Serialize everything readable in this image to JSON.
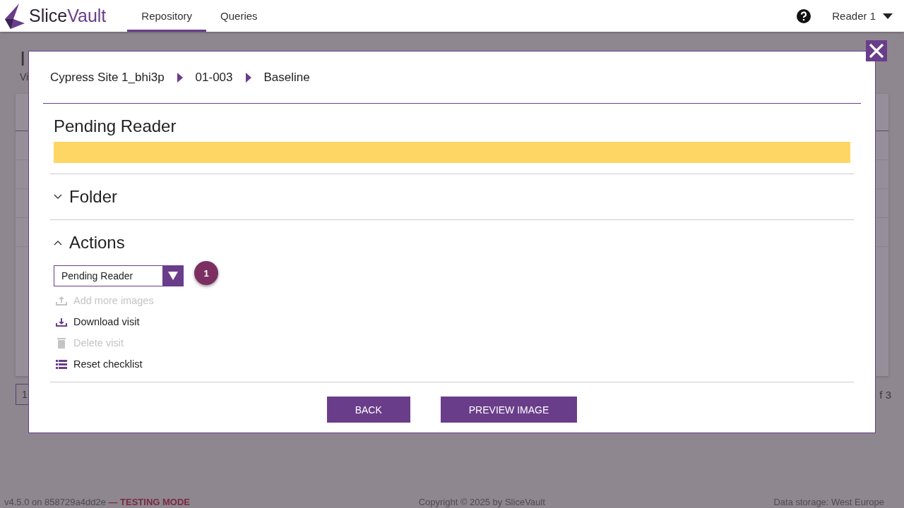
{
  "header": {
    "brand_first": "Slice",
    "brand_second": "Vault",
    "tabs": [
      {
        "label": "Repository",
        "selected": true
      },
      {
        "label": "Queries",
        "selected": false
      }
    ],
    "user": "Reader 1"
  },
  "background": {
    "title": "I",
    "subtitle": "Vi",
    "page": "1",
    "page_count": "f 3"
  },
  "modal": {
    "breadcrumb": [
      "Cypress Site 1_bhi3p",
      "01-003",
      "Baseline"
    ],
    "status": "Pending Reader",
    "sections": [
      {
        "title": "Folder",
        "expanded": false
      },
      {
        "title": "Actions",
        "expanded": true
      }
    ],
    "select_value": "Pending Reader",
    "badge": "1",
    "actions": [
      {
        "label": "Add more images",
        "kind": "upload",
        "disabled": true
      },
      {
        "label": "Download visit",
        "kind": "download",
        "disabled": false
      },
      {
        "label": "Delete visit",
        "kind": "delete",
        "disabled": true
      },
      {
        "label": "Reset checklist",
        "kind": "list",
        "disabled": false
      }
    ],
    "buttons": [
      "BACK",
      "PREVIEW IMAGE"
    ]
  },
  "footer": {
    "version": "v4.5.0 on 858729a4dd2e",
    "mode": "— TESTING MODE",
    "copyright": "Copyright © 2025 by SliceVault",
    "storage": "Data storage: West Europe"
  }
}
